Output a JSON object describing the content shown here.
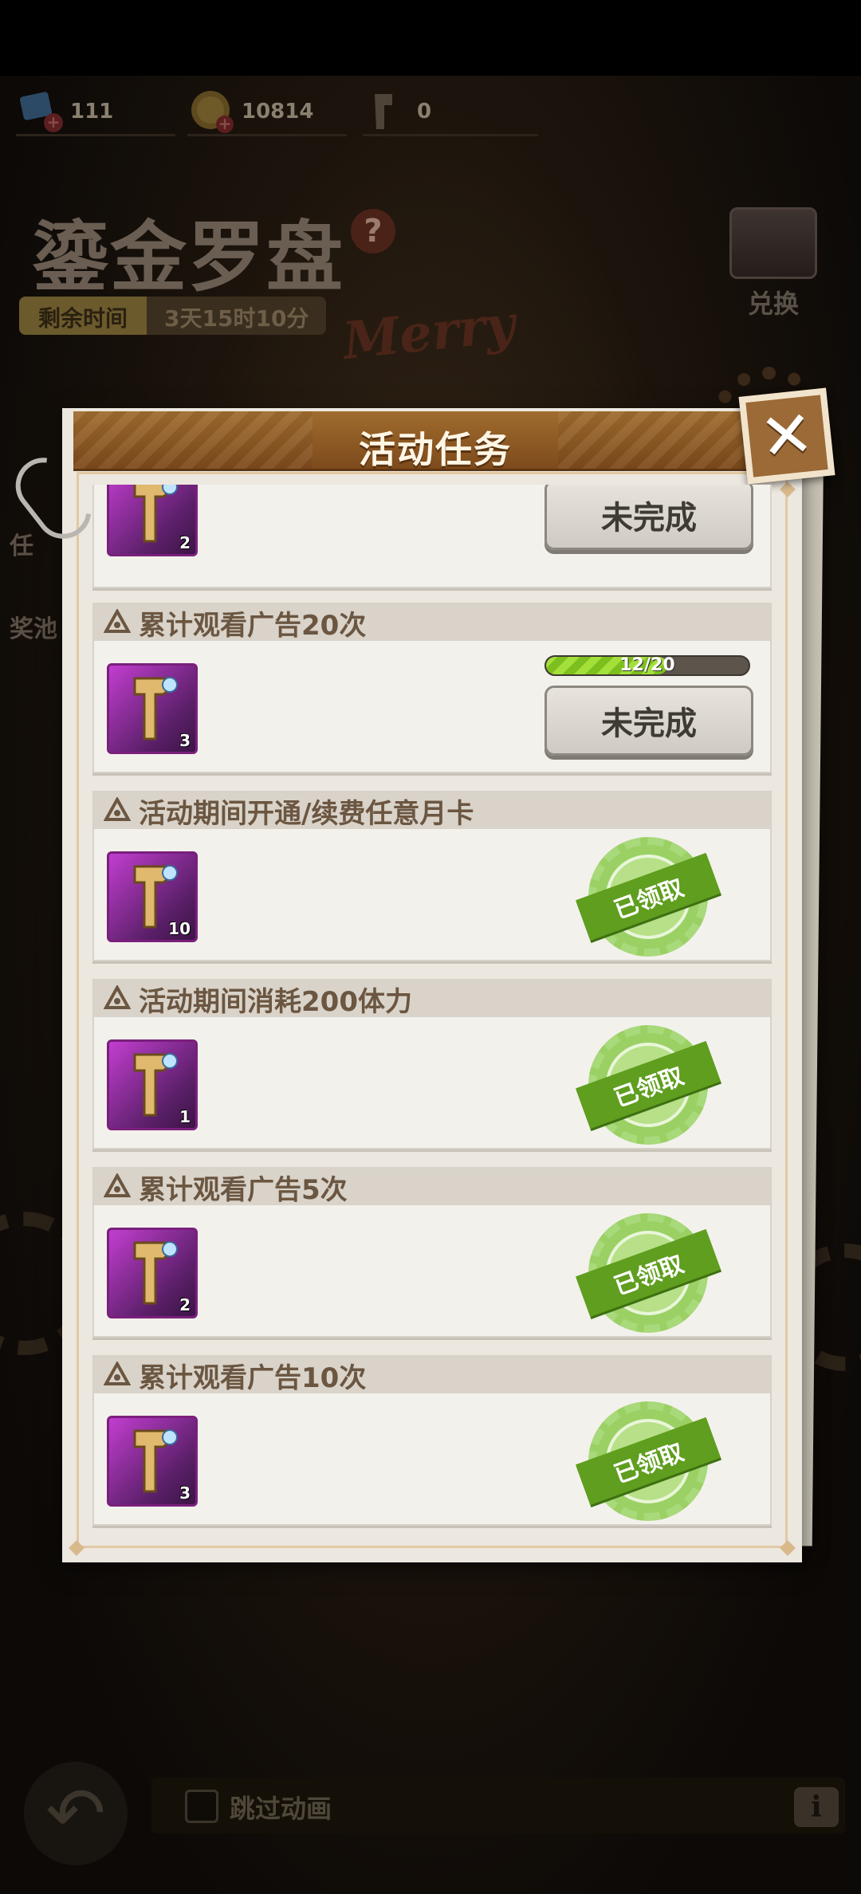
{
  "resources": [
    {
      "icon": "blue-ticket-icon",
      "value": "111"
    },
    {
      "icon": "gold-coin-icon",
      "value": "10814"
    },
    {
      "icon": "staff-key-icon",
      "value": "0"
    }
  ],
  "event": {
    "title": "鎏金罗盘",
    "help": "?",
    "time_label": "剩余时间",
    "time_value": "3天15时10分",
    "exchange_label": "兑换",
    "banner_text": "Merry",
    "side_labels": [
      "任",
      "奖池"
    ]
  },
  "modal": {
    "title": "活动任务",
    "close": "✕"
  },
  "tasks": [
    {
      "name": "",
      "count": "2",
      "status": "not_done",
      "button": "未完成"
    },
    {
      "name": "累计观看广告20次",
      "count": "3",
      "status": "not_done",
      "button": "未完成",
      "progress_text": "12/20",
      "progress": 0.6
    },
    {
      "name": "活动期间开通/续费任意月卡",
      "count": "10",
      "status": "claimed",
      "stamp": "已领取"
    },
    {
      "name": "活动期间消耗200体力",
      "count": "1",
      "status": "claimed",
      "stamp": "已领取"
    },
    {
      "name": "累计观看广告5次",
      "count": "2",
      "status": "claimed",
      "stamp": "已领取"
    },
    {
      "name": "累计观看广告10次",
      "count": "3",
      "status": "claimed",
      "stamp": "已领取"
    }
  ],
  "footer": {
    "skip_label": "跳过动画",
    "info": "i"
  },
  "colors": {
    "accent_green": "#5f9e1e",
    "header_brown": "#8d5a24",
    "item_purple": "#c23ed0"
  }
}
